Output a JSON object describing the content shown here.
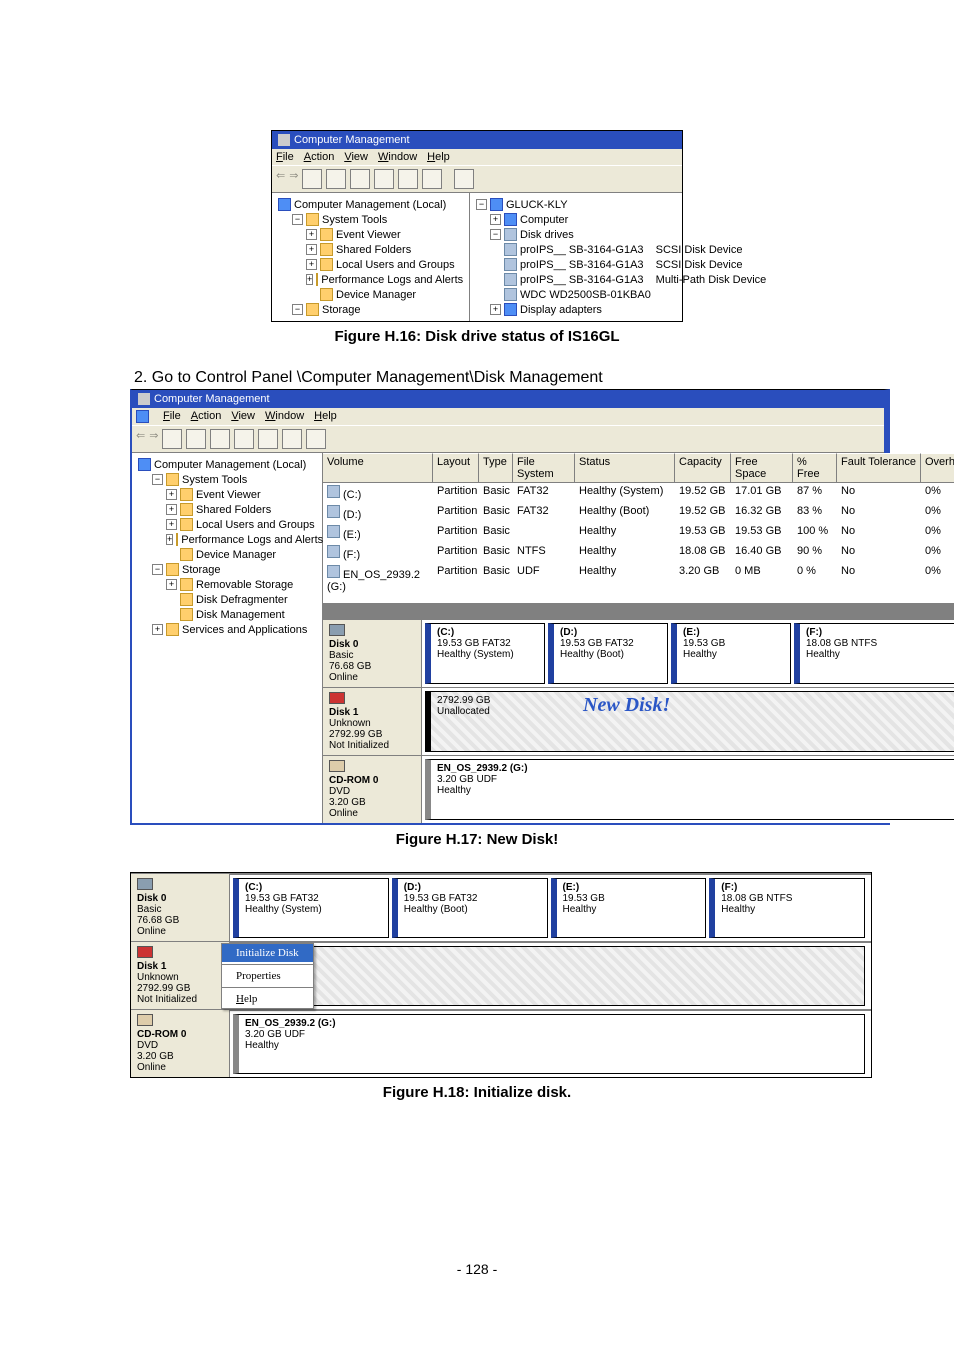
{
  "captions": {
    "h16": "Figure H.16: Disk drive status of IS16GL",
    "h17": "Figure H.17: New Disk!",
    "h18": "Figure H.18: Initialize disk."
  },
  "step2": "2.  Go to Control Panel \\Computer Management\\Disk Management",
  "page_number": "- 128 -",
  "win_title": "Computer Management",
  "menu": {
    "file": "File",
    "action": "Action",
    "view": "View",
    "window": "Window",
    "help": "Help"
  },
  "tree1_left": {
    "root": "Computer Management (Local)",
    "systools": "System Tools",
    "ev": "Event Viewer",
    "sf": "Shared Folders",
    "lug": "Local Users and Groups",
    "pla": "Performance Logs and Alerts",
    "dm": "Device Manager",
    "storage": "Storage"
  },
  "tree1_right": {
    "host": "GLUCK-KLY",
    "computer": "Computer",
    "dd": "Disk drives",
    "d1": "proIPS__ SB-3164-G1A3",
    "d1t": "SCSI Disk Device",
    "d2": "proIPS__ SB-3164-G1A3",
    "d2t": "SCSI Disk Device",
    "d3": "proIPS__ SB-3164-G1A3",
    "d3t": "Multi-Path Disk Device",
    "d4": "WDC WD2500SB-01KBA0",
    "da": "Display adapters"
  },
  "tree2_extra": {
    "removable": "Removable Storage",
    "defrag": "Disk Defragmenter",
    "diskmgmt": "Disk Management",
    "services": "Services and Applications"
  },
  "vol_head": {
    "volume": "Volume",
    "layout": "Layout",
    "type": "Type",
    "fs": "File System",
    "status": "Status",
    "cap": "Capacity",
    "free": "Free Space",
    "pct": "% Free",
    "ft": "Fault Tolerance",
    "oh": "Overhead"
  },
  "volumes": [
    {
      "vol": "(C:)",
      "layout": "Partition",
      "type": "Basic",
      "fs": "FAT32",
      "status": "Healthy (System)",
      "cap": "19.52 GB",
      "free": "17.01 GB",
      "pct": "87 %",
      "ft": "No",
      "oh": "0%"
    },
    {
      "vol": "(D:)",
      "layout": "Partition",
      "type": "Basic",
      "fs": "FAT32",
      "status": "Healthy (Boot)",
      "cap": "19.52 GB",
      "free": "16.32 GB",
      "pct": "83 %",
      "ft": "No",
      "oh": "0%"
    },
    {
      "vol": "(E:)",
      "layout": "Partition",
      "type": "Basic",
      "fs": "",
      "status": "Healthy",
      "cap": "19.53 GB",
      "free": "19.53 GB",
      "pct": "100 %",
      "ft": "No",
      "oh": "0%"
    },
    {
      "vol": "(F:)",
      "layout": "Partition",
      "type": "Basic",
      "fs": "NTFS",
      "status": "Healthy",
      "cap": "18.08 GB",
      "free": "16.40 GB",
      "pct": "90 %",
      "ft": "No",
      "oh": "0%"
    },
    {
      "vol": "EN_OS_2939.2 (G:)",
      "layout": "Partition",
      "type": "Basic",
      "fs": "UDF",
      "status": "Healthy",
      "cap": "3.20 GB",
      "free": "0 MB",
      "pct": "0 %",
      "ft": "No",
      "oh": "0%"
    }
  ],
  "disk0": {
    "name": "Disk 0",
    "type": "Basic",
    "size": "76.68 GB",
    "status": "Online",
    "c": {
      "label": "(C:)",
      "l2": "19.53 GB FAT32",
      "l3": "Healthy (System)"
    },
    "d": {
      "label": "(D:)",
      "l2": "19.53 GB FAT32",
      "l3": "Healthy (Boot)"
    },
    "e": {
      "label": "(E:)",
      "l2": "19.53 GB",
      "l3": "Healthy"
    },
    "f": {
      "label": "(F:)",
      "l2": "18.08 GB NTFS",
      "l3": "Healthy"
    }
  },
  "disk1": {
    "name": "Disk 1",
    "type": "Unknown",
    "size": "2792.99 GB",
    "status": "Not Initialized",
    "unalloc": {
      "l1": "2792.99 GB",
      "l2": "Unallocated"
    },
    "callout": "New Disk!"
  },
  "cdrom": {
    "name": "CD-ROM 0",
    "type": "DVD",
    "size": "3.20 GB",
    "status": "Online",
    "g": {
      "label": "EN_OS_2939.2 (G:)",
      "l2": "3.20 GB UDF",
      "l3": "Healthy"
    }
  },
  "ctx": {
    "init": "Initialize Disk",
    "prop": "Properties",
    "help": "Help"
  }
}
